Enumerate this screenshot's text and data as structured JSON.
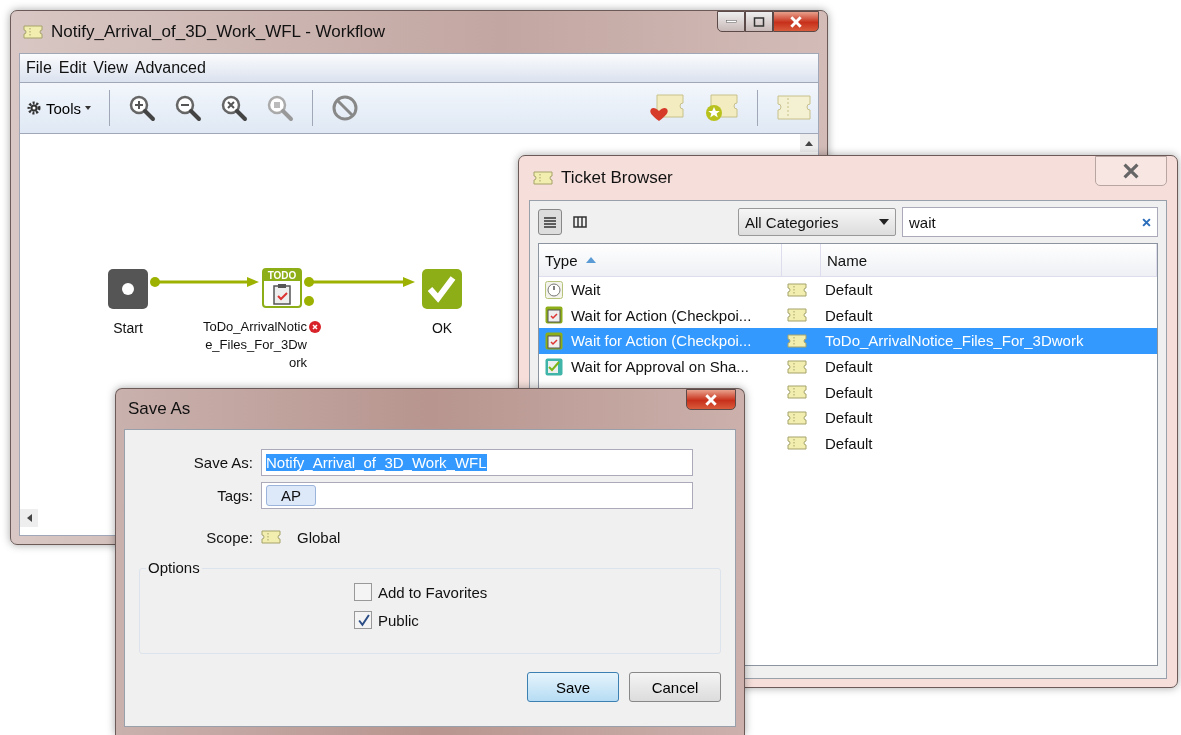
{
  "workflow_window": {
    "title": "Notify_Arrival_of_3D_Work_WFL - Workflow",
    "menu": [
      "File",
      "Edit",
      "View",
      "Advanced"
    ],
    "tools_label": "Tools",
    "nodes": [
      {
        "kind": "start",
        "label": "Start"
      },
      {
        "kind": "todo",
        "badge": "TODO",
        "label": "ToDo_ArrivalNotice_Files_For_3Dwork",
        "error": true
      },
      {
        "kind": "ok",
        "label": "OK"
      }
    ]
  },
  "ticket_browser": {
    "title": "Ticket Browser",
    "category": "All Categories",
    "search": "wait",
    "columns": [
      {
        "label": "Type",
        "sorted": true
      },
      {
        "label": "Name",
        "sorted": false
      }
    ],
    "rows": [
      {
        "kind": "clock",
        "type": "Wait",
        "name": "Default",
        "selected": false
      },
      {
        "kind": "todo",
        "type": "Wait for Action (Checkpoi...",
        "name": "Default",
        "selected": false
      },
      {
        "kind": "todo",
        "type": "Wait for Action (Checkpoi...",
        "name": "ToDo_ArrivalNotice_Files_For_3Dwork",
        "selected": true
      },
      {
        "kind": "approval",
        "type": "Wait for Approval on Sha...",
        "name": "Default",
        "selected": false
      },
      {
        "name": "Default",
        "selected": false
      },
      {
        "name": "Default",
        "selected": false
      },
      {
        "name": "Default",
        "selected": false
      }
    ]
  },
  "save_as": {
    "title": "Save As",
    "name_label": "Save As:",
    "name_value": "Notify_Arrival_of_3D_Work_WFL",
    "tags_label": "Tags:",
    "tags": [
      "AP"
    ],
    "scope_label": "Scope:",
    "scope": "Global",
    "options_label": "Options",
    "options": [
      {
        "label": "Add to Favorites",
        "checked": false
      },
      {
        "label": "Public",
        "checked": true
      }
    ],
    "buttons": [
      {
        "label": "Save",
        "default": true
      },
      {
        "label": "Cancel",
        "default": false
      }
    ]
  }
}
